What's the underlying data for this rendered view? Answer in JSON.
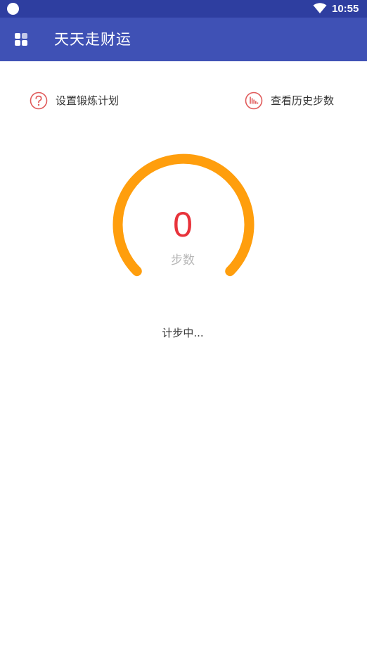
{
  "status_bar": {
    "time": "10:55"
  },
  "app_bar": {
    "title": "天天走财运",
    "menu_icon": "apps-grid-icon"
  },
  "actions": {
    "left": {
      "label": "设置锻炼计划",
      "icon": "question-circle-icon"
    },
    "right": {
      "label": "查看历史步数",
      "icon": "bar-chart-circle-icon"
    }
  },
  "gauge": {
    "steps": "0",
    "unit_label": "步数",
    "arc_color": "#ff9e0d",
    "value_color": "#e8333b"
  },
  "status_text": "计步中...",
  "colors": {
    "status_bar": "#2e3ea0",
    "app_bar": "#3f51b5",
    "icon_accent": "#e05a5a"
  }
}
